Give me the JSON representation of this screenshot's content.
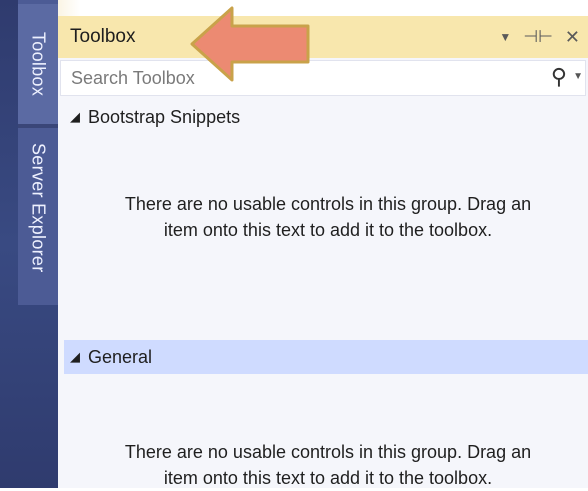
{
  "tabs": {
    "toolbox": "Toolbox",
    "server_explorer": "Server Explorer"
  },
  "panel": {
    "title": "Toolbox",
    "search": {
      "placeholder": "Search Toolbox"
    }
  },
  "groups": [
    {
      "name": "Bootstrap Snippets",
      "message_line1": "There are no usable controls in this group. Drag an",
      "message_line2": "item onto this text to add it to the toolbox."
    },
    {
      "name": "General",
      "message_line1": "There are no usable controls in this group. Drag an",
      "message_line2": "item onto this text to add it to the toolbox."
    }
  ],
  "icons": {
    "dropdown": "chevron-down-icon",
    "pin": "pin-icon",
    "close": "close-icon",
    "search": "search-icon",
    "expand": "triangle-expanded-icon",
    "arrow": "callout-arrow-icon"
  },
  "colors": {
    "titlebar": "#f8e7ad",
    "tabstrip": "#2f3b6e",
    "selected_group": "#cfdbff",
    "arrow_fill": "#ec8a72",
    "arrow_stroke": "#c9a24a"
  }
}
